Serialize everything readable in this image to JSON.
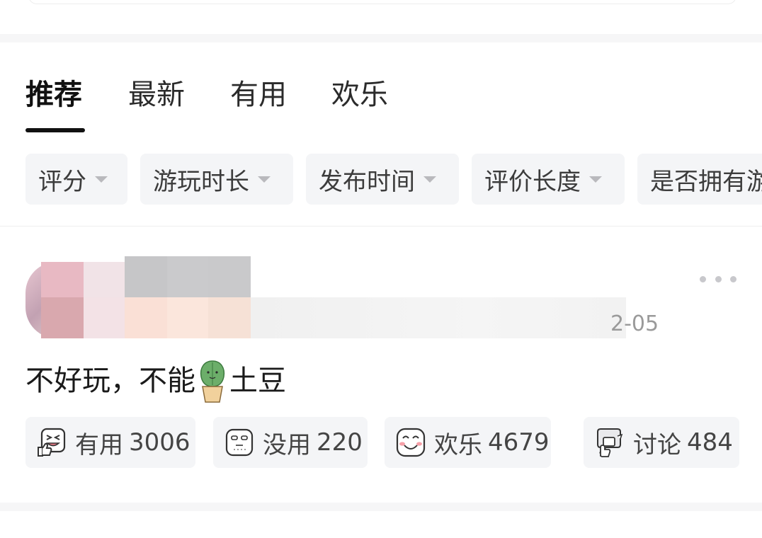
{
  "tabs": [
    {
      "label": "推荐",
      "active": true
    },
    {
      "label": "最新",
      "active": false
    },
    {
      "label": "有用",
      "active": false
    },
    {
      "label": "欢乐",
      "active": false
    }
  ],
  "filters": [
    {
      "label": "评分"
    },
    {
      "label": "游玩时长"
    },
    {
      "label": "发布时间"
    },
    {
      "label": "评价长度"
    },
    {
      "label": "是否拥有游"
    }
  ],
  "review": {
    "date_visible": "2-05",
    "text_before": "不好玩，不能",
    "text_after": "土豆",
    "emoji_icon": "cactus-pot-emoji"
  },
  "actions": [
    {
      "icon": "laugh-thumb-icon",
      "label": "有用",
      "count": "3006"
    },
    {
      "icon": "blank-face-icon",
      "label": "没用",
      "count": "220"
    },
    {
      "icon": "smile-blush-icon",
      "label": "欢乐",
      "count": "4679"
    },
    {
      "icon": "chat-hand-icon",
      "label": "讨论",
      "count": "484"
    }
  ],
  "colors": {
    "chip_bg": "#f4f5f7",
    "text_primary": "#1a1a1a",
    "text_secondary": "#9a9a9a",
    "band": "#f6f6f7"
  }
}
